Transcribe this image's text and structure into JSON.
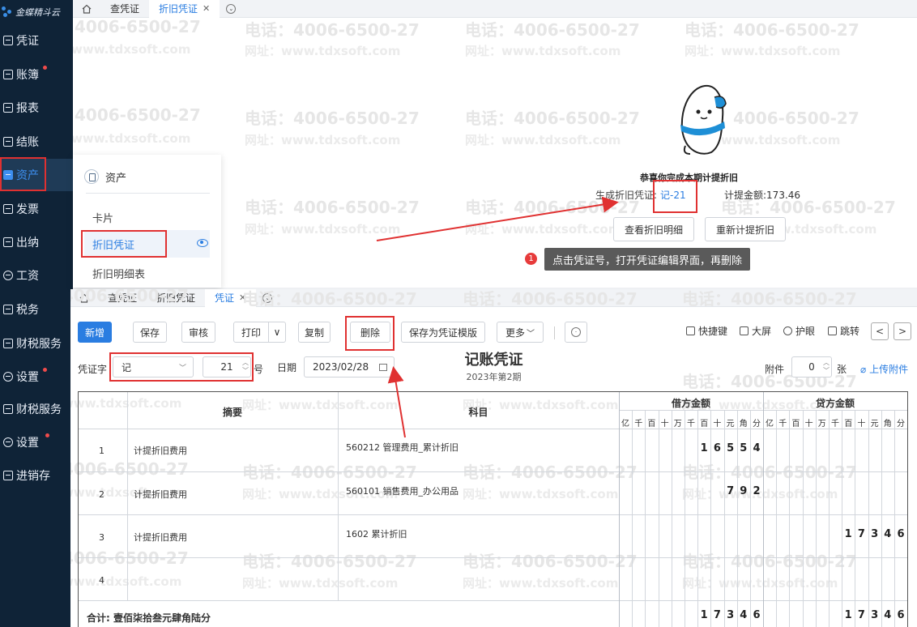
{
  "app": {
    "logo_text": "金蝶精斗云"
  },
  "watermark": {
    "phone": "电话：4006-6500-27",
    "phone_short": "4006-6500-27",
    "site": "网址：www.tdxsoft.com",
    "site_short": "www.tdxsoft.com"
  },
  "sidebar": {
    "items": [
      {
        "label": "凭证"
      },
      {
        "label": "账簿"
      },
      {
        "label": "报表"
      },
      {
        "label": "结账"
      },
      {
        "label": "资产"
      },
      {
        "label": "发票"
      },
      {
        "label": "出纳"
      },
      {
        "label": "工资"
      },
      {
        "label": "税务"
      },
      {
        "label": "财税服务"
      },
      {
        "label": "设置"
      },
      {
        "label": "财税服务"
      },
      {
        "label": "设置"
      },
      {
        "label": "进销存"
      }
    ]
  },
  "top_tabs": [
    "查凭证",
    "折旧凭证"
  ],
  "flyout": {
    "title": "资产",
    "items": [
      "卡片",
      "折旧凭证",
      "折旧明细表"
    ]
  },
  "result": {
    "congrats": "恭喜你完成本期计提折旧",
    "gen_label": "生成折旧凭证:",
    "voucher_link": "记-21",
    "amount_label": "计提金额:",
    "amount": "173.46",
    "btn_detail": "查看折旧明细",
    "btn_recalc": "重新计提折旧",
    "tip_num": "1",
    "tip": "点击凭证号，打开凭证编辑界面，再删除"
  },
  "bottom_tabs": [
    "查凭证",
    "折旧凭证",
    "凭证"
  ],
  "toolbar": {
    "new": "新增",
    "save": "保存",
    "audit": "审核",
    "print": "打印",
    "print_arrow": "∨",
    "copy": "复制",
    "delete": "删除",
    "save_tpl": "保存为凭证模版",
    "more": "更多",
    "shortcut": "快捷键",
    "fullscreen": "大屏",
    "eyecare": "护眼",
    "jump": "跳转",
    "prev": "<",
    "next": ">"
  },
  "voucher": {
    "word_label": "凭证字",
    "word": "记",
    "number": "21",
    "num_label": "号",
    "date_label": "日期",
    "date": "2023/02/28",
    "title": "记账凭证",
    "period": "2023年第2期",
    "attach_label": "附件",
    "attach": "0",
    "attach_unit": "张",
    "upload": "上传附件"
  },
  "table": {
    "headers": {
      "summary": "摘要",
      "account": "科目",
      "debit": "借方金额",
      "credit": "贷方金额"
    },
    "digit_heads": [
      "亿",
      "千",
      "百",
      "十",
      "万",
      "千",
      "百",
      "十",
      "元",
      "角",
      "分"
    ],
    "rows": [
      {
        "no": "1",
        "summary": "计提折旧费用",
        "account": "560212 管理费用_累计折旧",
        "debit": "16554",
        "credit": ""
      },
      {
        "no": "2",
        "summary": "计提折旧费用",
        "account": "560101 销售费用_办公用品",
        "debit": "792",
        "credit": ""
      },
      {
        "no": "3",
        "summary": "计提折旧费用",
        "account": "1602 累计折旧",
        "debit": "",
        "credit": "17346"
      },
      {
        "no": "4",
        "summary": "",
        "account": "",
        "debit": "",
        "credit": ""
      }
    ],
    "total_label": "合计: 壹佰柒拾叁元肆角陆分",
    "total_debit": "17346",
    "total_credit": "17346"
  },
  "colors": {
    "accent": "#2a7de1",
    "sidebar": "#0f2337",
    "highlight": "#e03131"
  }
}
